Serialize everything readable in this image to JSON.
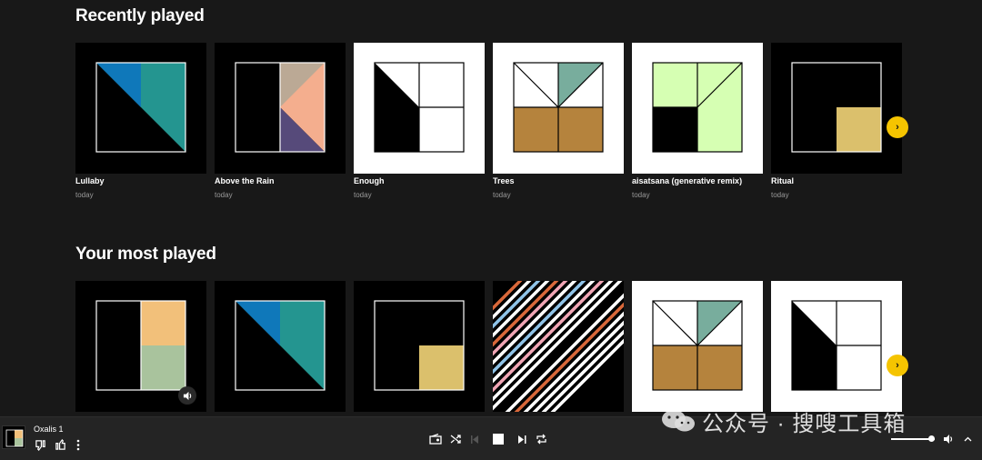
{
  "sections": {
    "recent": {
      "title": "Recently played",
      "items": [
        {
          "title": "Lullaby",
          "sub": "today"
        },
        {
          "title": "Above the Rain",
          "sub": "today"
        },
        {
          "title": "Enough",
          "sub": "today"
        },
        {
          "title": "Trees",
          "sub": "today"
        },
        {
          "title": "aisatsana (generative remix)",
          "sub": "today"
        },
        {
          "title": "Ritual",
          "sub": "today"
        }
      ]
    },
    "most": {
      "title": "Your most played"
    }
  },
  "player": {
    "now_title": "Oxalis 1",
    "volume_level": 0.92
  },
  "colors": {
    "accent": "#f5c400",
    "teal": "#249590",
    "blue": "#0f78ba",
    "peach": "#f4ae8e",
    "tan": "#bba995",
    "purple": "#564a7a",
    "gold_brown": "#b5833d",
    "green_teal": "#78ad9d",
    "lime": "#d6ffb3",
    "sand": "#dbc06c",
    "orange_sand": "#f2c07a",
    "sage": "#a9c39d"
  },
  "icons": [
    "next-chevron-icon",
    "volume-icon",
    "radio-icon",
    "shuffle-icon",
    "previous-icon",
    "stop-icon",
    "next-track-icon",
    "repeat-icon",
    "thumb-down-icon",
    "thumb-up-icon",
    "more-icon",
    "expand-icon",
    "wechat-icon"
  ],
  "watermark": "公众号 · 搜嗖工具箱"
}
